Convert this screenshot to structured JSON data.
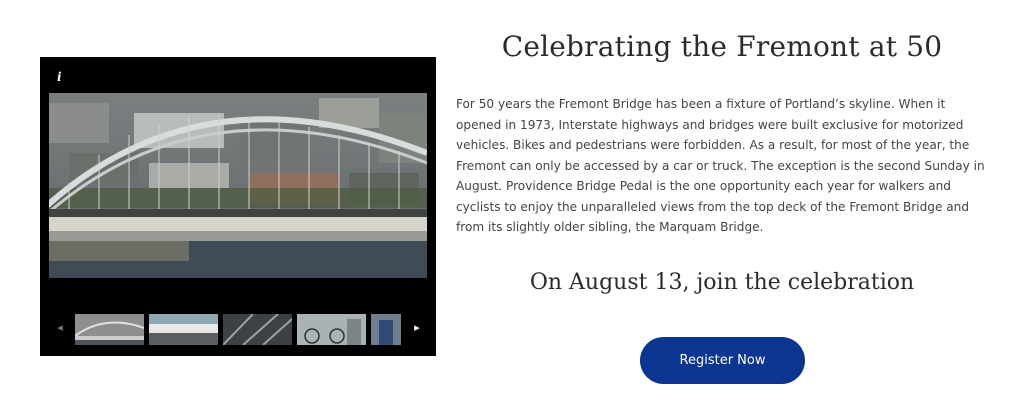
{
  "gallery": {
    "info_icon": "info-icon",
    "main_photo": "fremont-bridge-aerial",
    "prev_icon": "chevron-left-icon",
    "next_icon": "chevron-right-icon",
    "prev_glyph": "◂",
    "next_glyph": "▸",
    "info_glyph": "i",
    "thumbnails": [
      "bridge-aerial",
      "bridge-pedal-banner",
      "bridge-truss",
      "cyclist-crowd",
      "cyclist-rider"
    ]
  },
  "content": {
    "title": "Celebrating the Fremont at 50",
    "paragraph": "For 50 years the Fremont Bridge has been a fixture of Portland’s skyline. When it opened in 1973, Interstate highways and bridges were built exclusive for motorized vehicles. Bikes and pedestrians were forbidden. As a result, for most of the year, the Fremont can only be accessed by a car or truck. The exception is the second Sunday in August. Providence Bridge Pedal is the one opportunity each year for walkers and cyclists to enjoy the unparalleled views from the top deck of the Fremont Bridge and from its slightly older sibling, the Marquam Bridge.",
    "subtitle": "On August 13, join the celebration",
    "register_label": "Register Now"
  },
  "colors": {
    "button_bg": "#0a3591",
    "gallery_bg": "#000000"
  }
}
